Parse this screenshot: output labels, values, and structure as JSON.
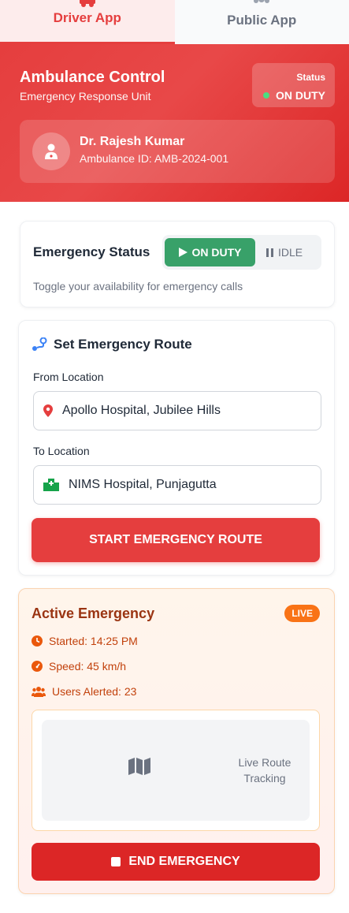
{
  "tabs": [
    {
      "label": "Driver App"
    },
    {
      "label": "Public App"
    }
  ],
  "header": {
    "title": "Ambulance Control",
    "subtitle": "Emergency Response Unit",
    "status_label": "Status",
    "status_value": "ON DUTY"
  },
  "driver": {
    "name": "Dr. Rajesh Kumar",
    "ambulance_id": "Ambulance ID: AMB-2024-001"
  },
  "emergency_status": {
    "title": "Emergency Status",
    "on_label": "ON DUTY",
    "off_label": "IDLE",
    "hint": "Toggle your availability for emergency calls"
  },
  "route": {
    "title": "Set Emergency Route",
    "from_label": "From Location",
    "from_value": "Apollo Hospital, Jubilee Hills",
    "to_label": "To Location",
    "to_value": "NIMS Hospital, Punjagutta",
    "start_button": "START EMERGENCY ROUTE"
  },
  "active": {
    "title": "Active Emergency",
    "badge": "LIVE",
    "started": "Started: 14:25 PM",
    "speed": "Speed: 45 km/h",
    "users_alerted": "Users Alerted: 23",
    "map_text": "Live Route Tracking",
    "end_button": "END EMERGENCY"
  },
  "colors": {
    "primary_red": "#e53e3e",
    "success_green": "#38a169",
    "live_orange": "#f97316"
  }
}
